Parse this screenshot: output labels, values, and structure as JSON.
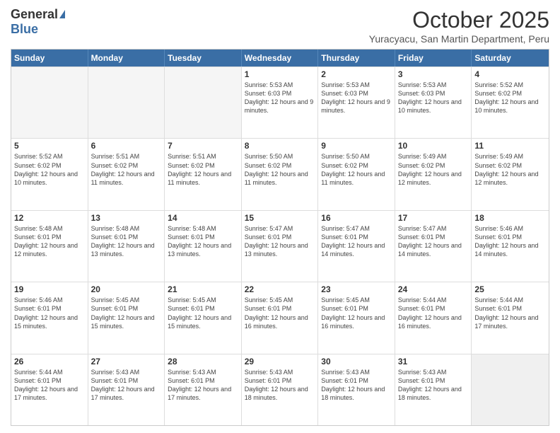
{
  "logo": {
    "general": "General",
    "blue": "Blue"
  },
  "title": "October 2025",
  "location": "Yuracyacu, San Martin Department, Peru",
  "weekdays": [
    "Sunday",
    "Monday",
    "Tuesday",
    "Wednesday",
    "Thursday",
    "Friday",
    "Saturday"
  ],
  "rows": [
    [
      {
        "day": "",
        "sunrise": "",
        "sunset": "",
        "daylight": "",
        "empty": true
      },
      {
        "day": "",
        "sunrise": "",
        "sunset": "",
        "daylight": "",
        "empty": true
      },
      {
        "day": "",
        "sunrise": "",
        "sunset": "",
        "daylight": "",
        "empty": true
      },
      {
        "day": "1",
        "sunrise": "Sunrise: 5:53 AM",
        "sunset": "Sunset: 6:03 PM",
        "daylight": "Daylight: 12 hours and 9 minutes."
      },
      {
        "day": "2",
        "sunrise": "Sunrise: 5:53 AM",
        "sunset": "Sunset: 6:03 PM",
        "daylight": "Daylight: 12 hours and 9 minutes."
      },
      {
        "day": "3",
        "sunrise": "Sunrise: 5:53 AM",
        "sunset": "Sunset: 6:03 PM",
        "daylight": "Daylight: 12 hours and 10 minutes."
      },
      {
        "day": "4",
        "sunrise": "Sunrise: 5:52 AM",
        "sunset": "Sunset: 6:02 PM",
        "daylight": "Daylight: 12 hours and 10 minutes."
      }
    ],
    [
      {
        "day": "5",
        "sunrise": "Sunrise: 5:52 AM",
        "sunset": "Sunset: 6:02 PM",
        "daylight": "Daylight: 12 hours and 10 minutes."
      },
      {
        "day": "6",
        "sunrise": "Sunrise: 5:51 AM",
        "sunset": "Sunset: 6:02 PM",
        "daylight": "Daylight: 12 hours and 11 minutes."
      },
      {
        "day": "7",
        "sunrise": "Sunrise: 5:51 AM",
        "sunset": "Sunset: 6:02 PM",
        "daylight": "Daylight: 12 hours and 11 minutes."
      },
      {
        "day": "8",
        "sunrise": "Sunrise: 5:50 AM",
        "sunset": "Sunset: 6:02 PM",
        "daylight": "Daylight: 12 hours and 11 minutes."
      },
      {
        "day": "9",
        "sunrise": "Sunrise: 5:50 AM",
        "sunset": "Sunset: 6:02 PM",
        "daylight": "Daylight: 12 hours and 11 minutes."
      },
      {
        "day": "10",
        "sunrise": "Sunrise: 5:49 AM",
        "sunset": "Sunset: 6:02 PM",
        "daylight": "Daylight: 12 hours and 12 minutes."
      },
      {
        "day": "11",
        "sunrise": "Sunrise: 5:49 AM",
        "sunset": "Sunset: 6:02 PM",
        "daylight": "Daylight: 12 hours and 12 minutes."
      }
    ],
    [
      {
        "day": "12",
        "sunrise": "Sunrise: 5:48 AM",
        "sunset": "Sunset: 6:01 PM",
        "daylight": "Daylight: 12 hours and 12 minutes."
      },
      {
        "day": "13",
        "sunrise": "Sunrise: 5:48 AM",
        "sunset": "Sunset: 6:01 PM",
        "daylight": "Daylight: 12 hours and 13 minutes."
      },
      {
        "day": "14",
        "sunrise": "Sunrise: 5:48 AM",
        "sunset": "Sunset: 6:01 PM",
        "daylight": "Daylight: 12 hours and 13 minutes."
      },
      {
        "day": "15",
        "sunrise": "Sunrise: 5:47 AM",
        "sunset": "Sunset: 6:01 PM",
        "daylight": "Daylight: 12 hours and 13 minutes."
      },
      {
        "day": "16",
        "sunrise": "Sunrise: 5:47 AM",
        "sunset": "Sunset: 6:01 PM",
        "daylight": "Daylight: 12 hours and 14 minutes."
      },
      {
        "day": "17",
        "sunrise": "Sunrise: 5:47 AM",
        "sunset": "Sunset: 6:01 PM",
        "daylight": "Daylight: 12 hours and 14 minutes."
      },
      {
        "day": "18",
        "sunrise": "Sunrise: 5:46 AM",
        "sunset": "Sunset: 6:01 PM",
        "daylight": "Daylight: 12 hours and 14 minutes."
      }
    ],
    [
      {
        "day": "19",
        "sunrise": "Sunrise: 5:46 AM",
        "sunset": "Sunset: 6:01 PM",
        "daylight": "Daylight: 12 hours and 15 minutes."
      },
      {
        "day": "20",
        "sunrise": "Sunrise: 5:45 AM",
        "sunset": "Sunset: 6:01 PM",
        "daylight": "Daylight: 12 hours and 15 minutes."
      },
      {
        "day": "21",
        "sunrise": "Sunrise: 5:45 AM",
        "sunset": "Sunset: 6:01 PM",
        "daylight": "Daylight: 12 hours and 15 minutes."
      },
      {
        "day": "22",
        "sunrise": "Sunrise: 5:45 AM",
        "sunset": "Sunset: 6:01 PM",
        "daylight": "Daylight: 12 hours and 16 minutes."
      },
      {
        "day": "23",
        "sunrise": "Sunrise: 5:45 AM",
        "sunset": "Sunset: 6:01 PM",
        "daylight": "Daylight: 12 hours and 16 minutes."
      },
      {
        "day": "24",
        "sunrise": "Sunrise: 5:44 AM",
        "sunset": "Sunset: 6:01 PM",
        "daylight": "Daylight: 12 hours and 16 minutes."
      },
      {
        "day": "25",
        "sunrise": "Sunrise: 5:44 AM",
        "sunset": "Sunset: 6:01 PM",
        "daylight": "Daylight: 12 hours and 17 minutes."
      }
    ],
    [
      {
        "day": "26",
        "sunrise": "Sunrise: 5:44 AM",
        "sunset": "Sunset: 6:01 PM",
        "daylight": "Daylight: 12 hours and 17 minutes."
      },
      {
        "day": "27",
        "sunrise": "Sunrise: 5:43 AM",
        "sunset": "Sunset: 6:01 PM",
        "daylight": "Daylight: 12 hours and 17 minutes."
      },
      {
        "day": "28",
        "sunrise": "Sunrise: 5:43 AM",
        "sunset": "Sunset: 6:01 PM",
        "daylight": "Daylight: 12 hours and 17 minutes."
      },
      {
        "day": "29",
        "sunrise": "Sunrise: 5:43 AM",
        "sunset": "Sunset: 6:01 PM",
        "daylight": "Daylight: 12 hours and 18 minutes."
      },
      {
        "day": "30",
        "sunrise": "Sunrise: 5:43 AM",
        "sunset": "Sunset: 6:01 PM",
        "daylight": "Daylight: 12 hours and 18 minutes."
      },
      {
        "day": "31",
        "sunrise": "Sunrise: 5:43 AM",
        "sunset": "Sunset: 6:01 PM",
        "daylight": "Daylight: 12 hours and 18 minutes."
      },
      {
        "day": "",
        "sunrise": "",
        "sunset": "",
        "daylight": "",
        "empty": true
      }
    ]
  ]
}
